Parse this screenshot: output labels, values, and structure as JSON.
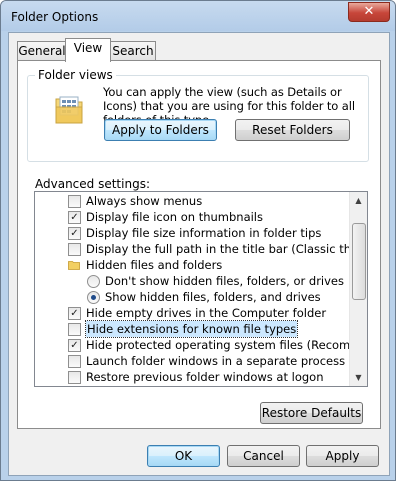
{
  "window": {
    "title": "Folder Options",
    "close_glyph": "✕"
  },
  "tabs": [
    {
      "label": "General",
      "active": false
    },
    {
      "label": "View",
      "active": true
    },
    {
      "label": "Search",
      "active": false
    }
  ],
  "folder_views": {
    "legend": "Folder views",
    "description": "You can apply the view (such as Details or Icons) that you are using for this folder to all folders of this type.",
    "apply_button": "Apply to Folders",
    "reset_button": "Reset Folders",
    "icon": "folder-view-icon"
  },
  "advanced": {
    "label": "Advanced settings:",
    "items": [
      {
        "kind": "checkbox",
        "label": "Always show menus",
        "checked": false,
        "indent": 1
      },
      {
        "kind": "checkbox",
        "label": "Display file icon on thumbnails",
        "checked": true,
        "indent": 1
      },
      {
        "kind": "checkbox",
        "label": "Display file size information in folder tips",
        "checked": true,
        "indent": 1
      },
      {
        "kind": "checkbox",
        "label": "Display the full path in the title bar (Classic theme only)",
        "checked": false,
        "indent": 1
      },
      {
        "kind": "folder",
        "label": "Hidden files and folders",
        "indent": 1
      },
      {
        "kind": "radio",
        "label": "Don't show hidden files, folders, or drives",
        "checked": false,
        "indent": 2
      },
      {
        "kind": "radio",
        "label": "Show hidden files, folders, and drives",
        "checked": true,
        "indent": 2
      },
      {
        "kind": "checkbox",
        "label": "Hide empty drives in the Computer folder",
        "checked": true,
        "indent": 1
      },
      {
        "kind": "checkbox",
        "label": "Hide extensions for known file types",
        "checked": false,
        "indent": 1,
        "selected": true
      },
      {
        "kind": "checkbox",
        "label": "Hide protected operating system files (Recommended)",
        "checked": true,
        "indent": 1
      },
      {
        "kind": "checkbox",
        "label": "Launch folder windows in a separate process",
        "checked": false,
        "indent": 1
      },
      {
        "kind": "checkbox",
        "label": "Restore previous folder windows at logon",
        "checked": false,
        "indent": 1
      }
    ],
    "scroll_up_glyph": "▲",
    "scroll_down_glyph": "▼",
    "check_glyph": "✓"
  },
  "restore_defaults_button": "Restore Defaults",
  "footer": {
    "ok": "OK",
    "cancel": "Cancel",
    "apply": "Apply"
  }
}
